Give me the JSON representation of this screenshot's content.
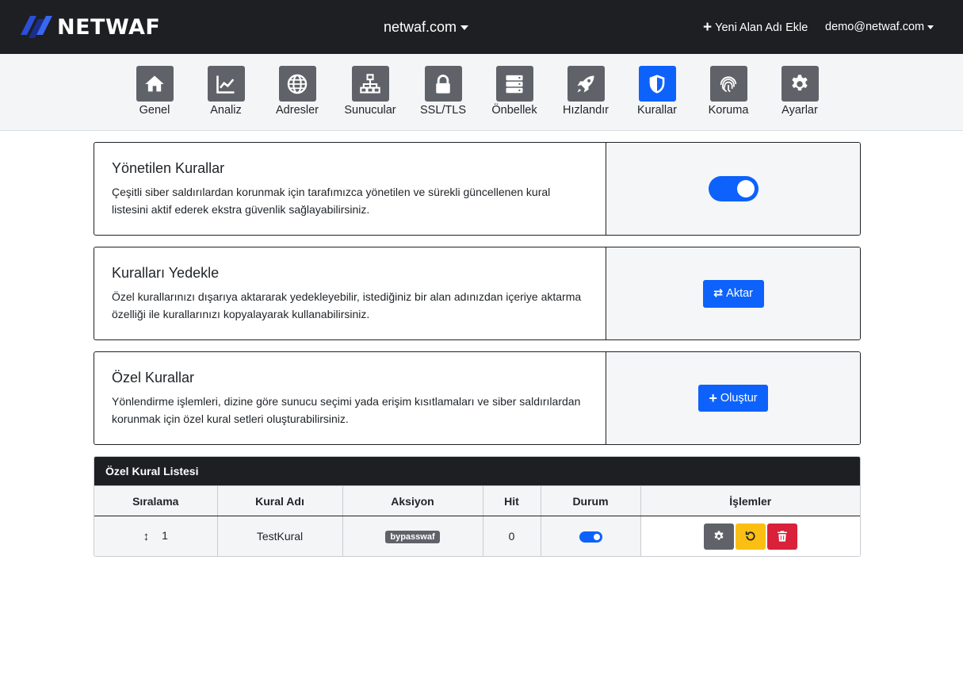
{
  "header": {
    "brand": "NETWAF",
    "domain": "netwaf.com",
    "add_domain": "Yeni Alan Adı Ekle",
    "user": "demo@netwaf.com"
  },
  "nav": {
    "items": [
      {
        "label": "Genel",
        "icon": "home-icon"
      },
      {
        "label": "Analiz",
        "icon": "chart-icon"
      },
      {
        "label": "Adresler",
        "icon": "globe-icon"
      },
      {
        "label": "Sunucular",
        "icon": "network-icon"
      },
      {
        "label": "SSL/TLS",
        "icon": "lock-icon"
      },
      {
        "label": "Önbellek",
        "icon": "server-icon"
      },
      {
        "label": "Hızlandır",
        "icon": "rocket-icon"
      },
      {
        "label": "Kurallar",
        "icon": "shield-icon",
        "active": true
      },
      {
        "label": "Koruma",
        "icon": "fingerprint-icon"
      },
      {
        "label": "Ayarlar",
        "icon": "gear-icon"
      }
    ]
  },
  "managed_rules": {
    "title": "Yönetilen Kurallar",
    "description": "Çeşitli siber saldırılardan korunmak için tarafımızca yönetilen ve sürekli güncellenen kural listesini aktif ederek ekstra güvenlik sağlayabilirsiniz.",
    "enabled": true
  },
  "backup_rules": {
    "title": "Kuralları Yedekle",
    "description": "Özel kurallarınızı dışarıya aktararak yedekleyebilir, istediğiniz bir alan adınızdan içeriye aktarma özelliği ile kurallarınızı kopyalayarak kullanabilirsiniz.",
    "button": "Aktar"
  },
  "custom_rules": {
    "title": "Özel Kurallar",
    "description": "Yönlendirme işlemleri, dizine göre sunucu seçimi yada erişim kısıtlamaları ve siber saldırılardan korunmak için özel kural setleri oluşturabilirsiniz.",
    "button": "Oluştur"
  },
  "rule_list": {
    "title": "Özel Kural Listesi",
    "columns": [
      "Sıralama",
      "Kural Adı",
      "Aksiyon",
      "Hit",
      "Durum",
      "İşlemler"
    ],
    "rows": [
      {
        "order": "1",
        "name": "TestKural",
        "action": "bypasswaf",
        "hit": "0",
        "enabled": true
      }
    ]
  },
  "colors": {
    "topbar": "#1e1f23",
    "accent": "#0d62fb",
    "nav_tile": "#5f6369",
    "warning": "#fbbf14",
    "danger": "#d9213a"
  }
}
